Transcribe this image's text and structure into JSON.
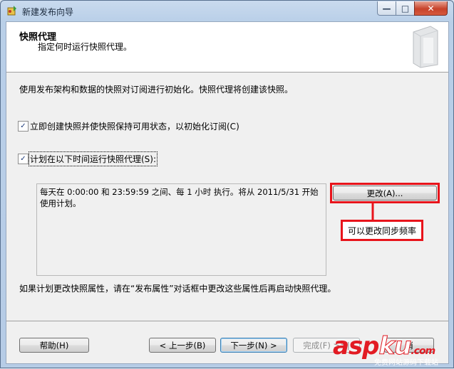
{
  "window": {
    "title": "新建发布向导",
    "controls": {
      "minimize": "—",
      "maximize": "□",
      "close": "✕"
    }
  },
  "header": {
    "title": "快照代理",
    "subtitle": "指定何时运行快照代理。"
  },
  "description": "使用发布架构和数据的快照对订阅进行初始化。快照代理将创建该快照。",
  "options": [
    {
      "label": "立即创建快照并使快照保持可用状态，以初始化订阅(C)",
      "checked": true,
      "mark": "✓"
    },
    {
      "label": "计划在以下时间运行快照代理(S):",
      "checked": true,
      "mark": "✓"
    }
  ],
  "schedule": {
    "text": "每天在 0:00:00 和 23:59:59 之间、每 1 小时 执行。将从 2011/5/31 开始使用计划。",
    "change_button": "更改(A)..."
  },
  "annotation": {
    "callout_text": "可以更改同步频率",
    "color": "#e8141b"
  },
  "note": "如果计划更改快照属性，请在“发布属性”对话框中更改这些属性后再启动快照代理。",
  "buttons": {
    "help": "帮助(H)",
    "back": "< 上一步(B)",
    "next": "下一步(N) >",
    "finish": "完成(F) >>|",
    "cancel": "消"
  },
  "watermark": {
    "main_a": "asp",
    "main_b": "ku",
    "tld": ".com",
    "sub": "免费网站源码下载站"
  }
}
